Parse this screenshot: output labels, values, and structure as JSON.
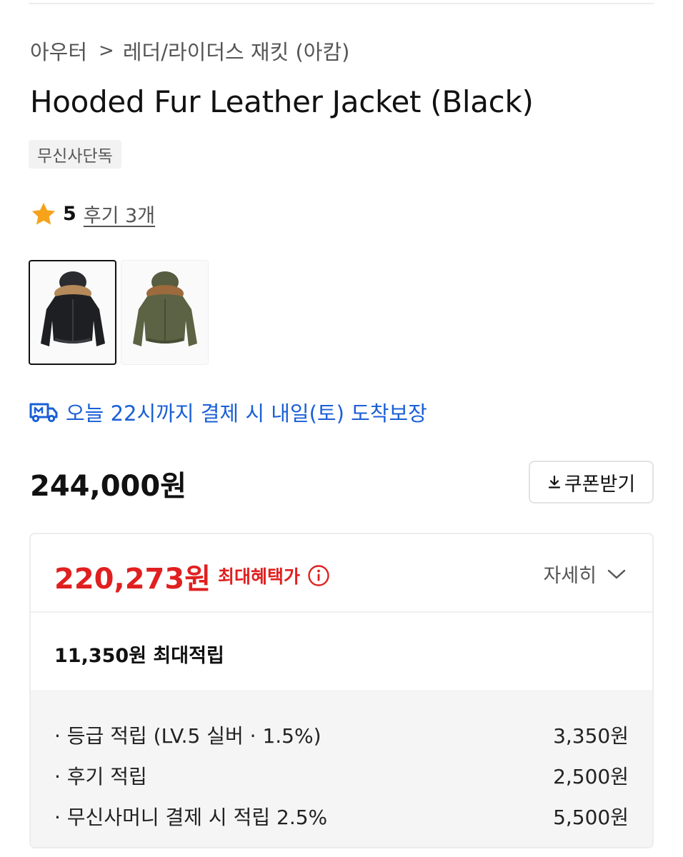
{
  "breadcrumb": {
    "items": [
      "아우터",
      "레더/라이더스 재킷 (아캄)"
    ],
    "separator": ">"
  },
  "product": {
    "title": "Hooded Fur Leather Jacket (Black)",
    "tag": "무신사단독",
    "rating": "5",
    "reviews": "후기 3개",
    "thumbnails": [
      {
        "name": "black-jacket",
        "color": "#1e1f22",
        "selected": true
      },
      {
        "name": "khaki-jacket",
        "color": "#5c6344",
        "selected": false
      }
    ]
  },
  "delivery": {
    "text": "오늘 22시까지 결제 시 내일(토) 도착보장",
    "color": "#1a5fd6",
    "icon": "truck-icon"
  },
  "price": {
    "original": "244,000원",
    "coupon_button": "쿠폰받기"
  },
  "benefit": {
    "price": "220,273원",
    "label": "최대혜택가",
    "detail_toggle": "자세히",
    "accent": "#e02020",
    "max_points": "11,350원 최대적립",
    "points": [
      {
        "label": "· 등급 적립 (LV.5 실버 · 1.5%)",
        "value": "3,350원"
      },
      {
        "label": "· 후기 적립",
        "value": "2,500원"
      },
      {
        "label": "· 무신사머니 결제 시 적립 2.5%",
        "value": "5,500원"
      }
    ]
  }
}
